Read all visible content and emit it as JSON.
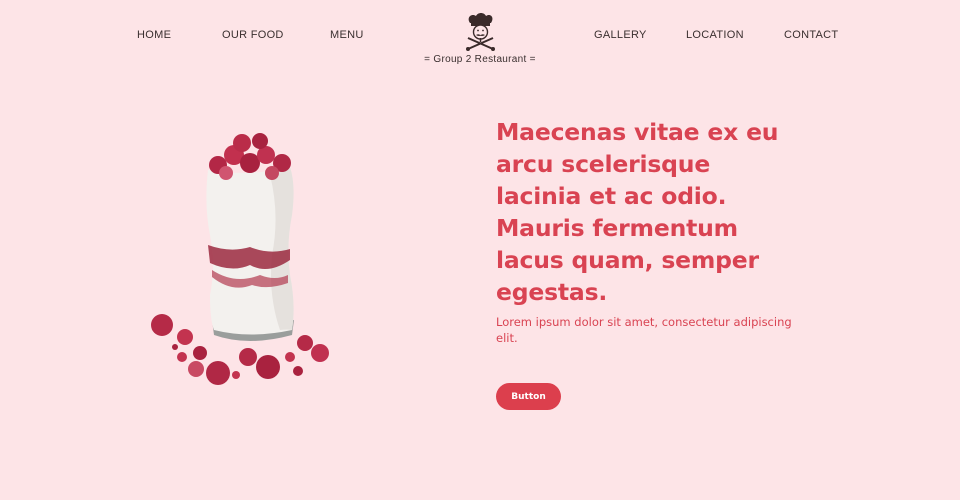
{
  "nav": {
    "left": [
      "HOME",
      "OUR FOOD",
      "MENU"
    ],
    "right": [
      "GALLERY",
      "LOCATION",
      "CONTACT"
    ]
  },
  "brand": {
    "name": "= Group 2 Restaurant ="
  },
  "hero": {
    "headline": "Maecenas vitae ex eu arcu scelerisque lacinia et ac odio. Mauris fermentum lacus quam, semper egestas.",
    "subtext": "Lorem ipsum dolor sit amet, consectetur adipiscing elit.",
    "button_label": "Button"
  },
  "colors": {
    "background": "#fde4e7",
    "accent": "#d94352",
    "button": "#dc3f4d"
  }
}
